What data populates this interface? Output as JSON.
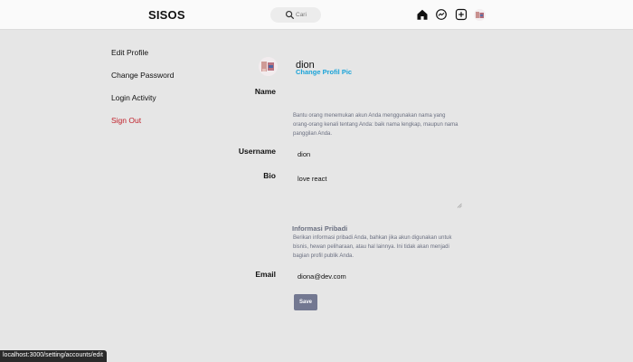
{
  "header": {
    "brand": "SISOS",
    "search_placeholder": "Cari",
    "icons": [
      "home-icon",
      "messenger-icon",
      "add-post-icon",
      "avatar"
    ]
  },
  "sidebar": {
    "items": [
      {
        "label": "Edit Profile"
      },
      {
        "label": "Change Password"
      },
      {
        "label": "Login Activity"
      },
      {
        "label": "Sign Out"
      }
    ],
    "signout_color": "#c0202a"
  },
  "profile": {
    "username": "dion",
    "change_pic_label": "Change Profil Pic",
    "link_color": "#1aa3d8"
  },
  "form": {
    "name_label": "Name",
    "name_help": "Bantu orang menemukan akun Anda menggunakan nama yang orang-orang kenali tentang Anda: baik nama lengkap, maupun nama panggilan Anda.",
    "username_label": "Username",
    "username_value": "dion",
    "bio_label": "Bio",
    "bio_value": "love react",
    "section_title": "Informasi Pribadi",
    "section_help": "Berikan informasi pribadi Anda, bahkan jika akun digunakan untuk bisnis, hewan peliharaan, atau hal lainnya. Ini tidak akan menjadi bagian profil publik Anda.",
    "email_label": "Email",
    "email_value": "diona@dev.com",
    "save_label": "Save",
    "save_color": "#737891"
  },
  "status_bar": {
    "url": "localhost:3000/setting/accounts/edit"
  }
}
